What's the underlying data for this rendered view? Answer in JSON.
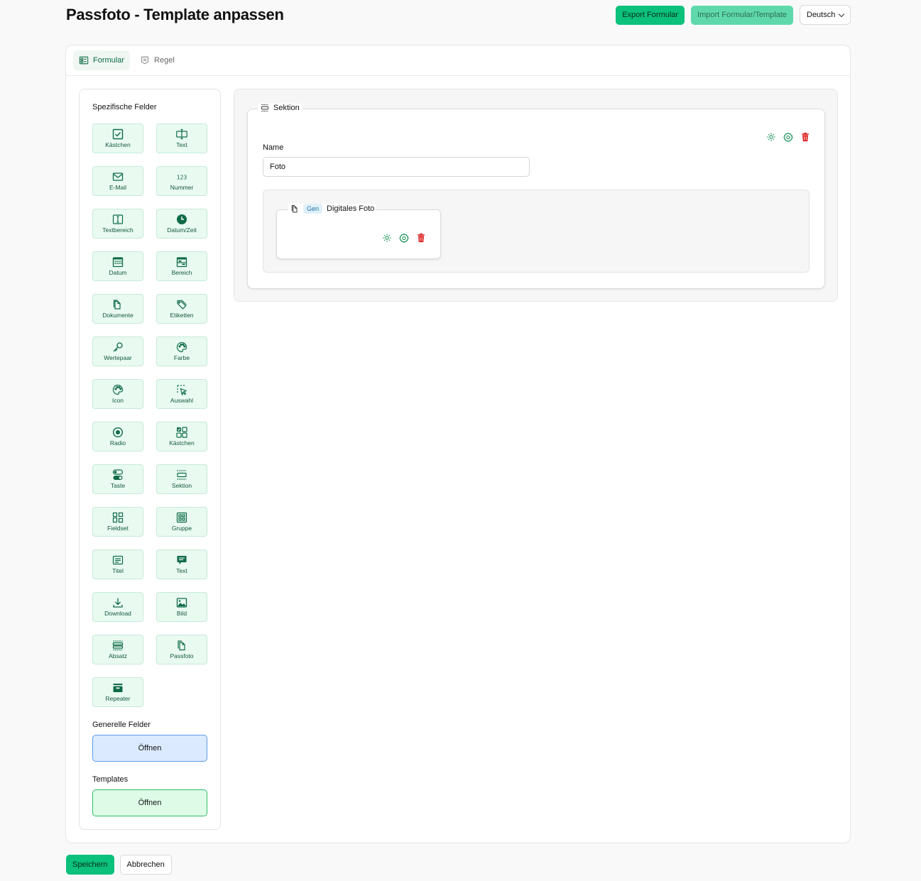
{
  "header": {
    "title": "Passfoto - Template anpassen",
    "export_label": "Export Formular",
    "import_label": "Import Formular/Template",
    "language": "Deutsch"
  },
  "tabs": [
    {
      "label": "Formular",
      "icon": "form-icon",
      "active": true
    },
    {
      "label": "Regel",
      "icon": "rule-icon",
      "active": false
    }
  ],
  "sidebar": {
    "specific_title": "Spezifische Felder",
    "fields": [
      {
        "label": "Kästchen",
        "icon": "checkbox-icon"
      },
      {
        "label": "Text",
        "icon": "text-input-icon"
      },
      {
        "label": "E-Mail",
        "icon": "mail-icon"
      },
      {
        "label": "Nummer",
        "icon": "number-icon"
      },
      {
        "label": "Textbereich",
        "icon": "textarea-icon"
      },
      {
        "label": "Datum/Zeit",
        "icon": "clock-icon"
      },
      {
        "label": "Datum",
        "icon": "calendar-icon"
      },
      {
        "label": "Bereich",
        "icon": "range-icon"
      },
      {
        "label": "Dokumente",
        "icon": "documents-icon"
      },
      {
        "label": "Etiketten",
        "icon": "tag-icon"
      },
      {
        "label": "Wertepaar",
        "icon": "key-icon"
      },
      {
        "label": "Farbe",
        "icon": "palette-icon"
      },
      {
        "label": "Icon",
        "icon": "palette-icon"
      },
      {
        "label": "Auswahl",
        "icon": "select-cursor-icon"
      },
      {
        "label": "Radio",
        "icon": "radio-icon"
      },
      {
        "label": "Kästchen",
        "icon": "checkbox-group-icon"
      },
      {
        "label": "Taste",
        "icon": "toggle-icon"
      },
      {
        "label": "Sektion",
        "icon": "section-icon"
      },
      {
        "label": "Fieldset",
        "icon": "fieldset-icon"
      },
      {
        "label": "Gruppe",
        "icon": "group-icon"
      },
      {
        "label": "Titel",
        "icon": "title-icon"
      },
      {
        "label": "Text",
        "icon": "message-icon"
      },
      {
        "label": "Download",
        "icon": "download-icon"
      },
      {
        "label": "Bild",
        "icon": "image-icon"
      },
      {
        "label": "Absatz",
        "icon": "paragraph-icon"
      },
      {
        "label": "Passfoto",
        "icon": "passphoto-icon"
      },
      {
        "label": "Repeater",
        "icon": "repeater-icon"
      }
    ],
    "general_title": "Generelle Felder",
    "general_button": "Öffnen",
    "templates_title": "Templates",
    "templates_button": "Öffnen"
  },
  "section": {
    "legend": "Sektion",
    "name_label": "Name",
    "name_value": "Foto",
    "photo_field": {
      "badge": "Gen",
      "label": "Digitales Foto"
    }
  },
  "footer": {
    "save_label": "Speichern",
    "cancel_label": "Abbrechen"
  },
  "colors": {
    "accent": "#0bc17c",
    "icon_green": "#0f6b47",
    "delete_red": "#dc1f1f"
  }
}
